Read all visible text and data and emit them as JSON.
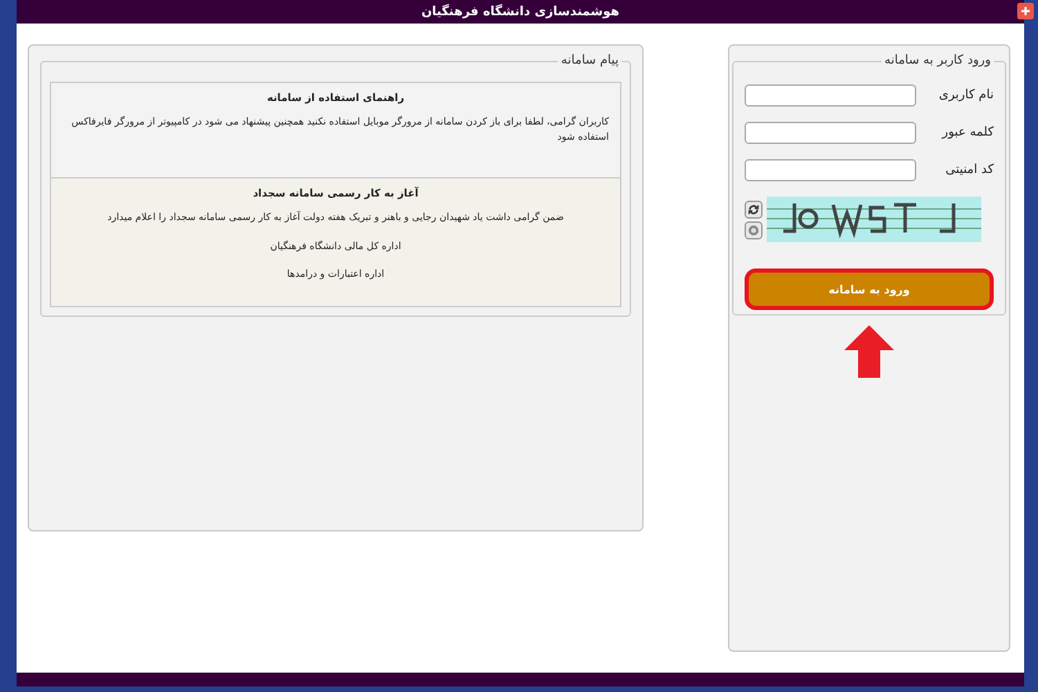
{
  "header": {
    "title": "هوشمندسازی دانشگاه فرهنگیان"
  },
  "messages": {
    "legend": "پیام سامانه",
    "items": [
      {
        "title": "راهنمای استفاده از سامانه",
        "lines": [
          "کاربران گرامی، لطفا برای باز کردن سامانه از مرورگر موبایل استفاده نکنید همچنین پیشنهاد می شود در کامپیوتر از مرورگر فایرفاکس استفاده شود"
        ],
        "kind": "guide"
      },
      {
        "title": "آغاز به کار رسمی سامانه سجداد",
        "lines": [
          "ضمن گرامی داشت یاد شهیدان رجایی و باهنر و تبریک هفته دولت آغاز به کار رسمی سامانه سجداد را اعلام میدارد",
          "اداره کل مالی دانشگاه فرهنگیان",
          "اداره اعتبارات و درامدها"
        ],
        "kind": "announcement"
      }
    ]
  },
  "login": {
    "legend": "ورود کاربر به سامانه",
    "fields": [
      {
        "label": "نام کاربری"
      },
      {
        "label": "کلمه عبور"
      },
      {
        "label": "کد امنیتی"
      }
    ],
    "button": "ورود به سامانه"
  }
}
